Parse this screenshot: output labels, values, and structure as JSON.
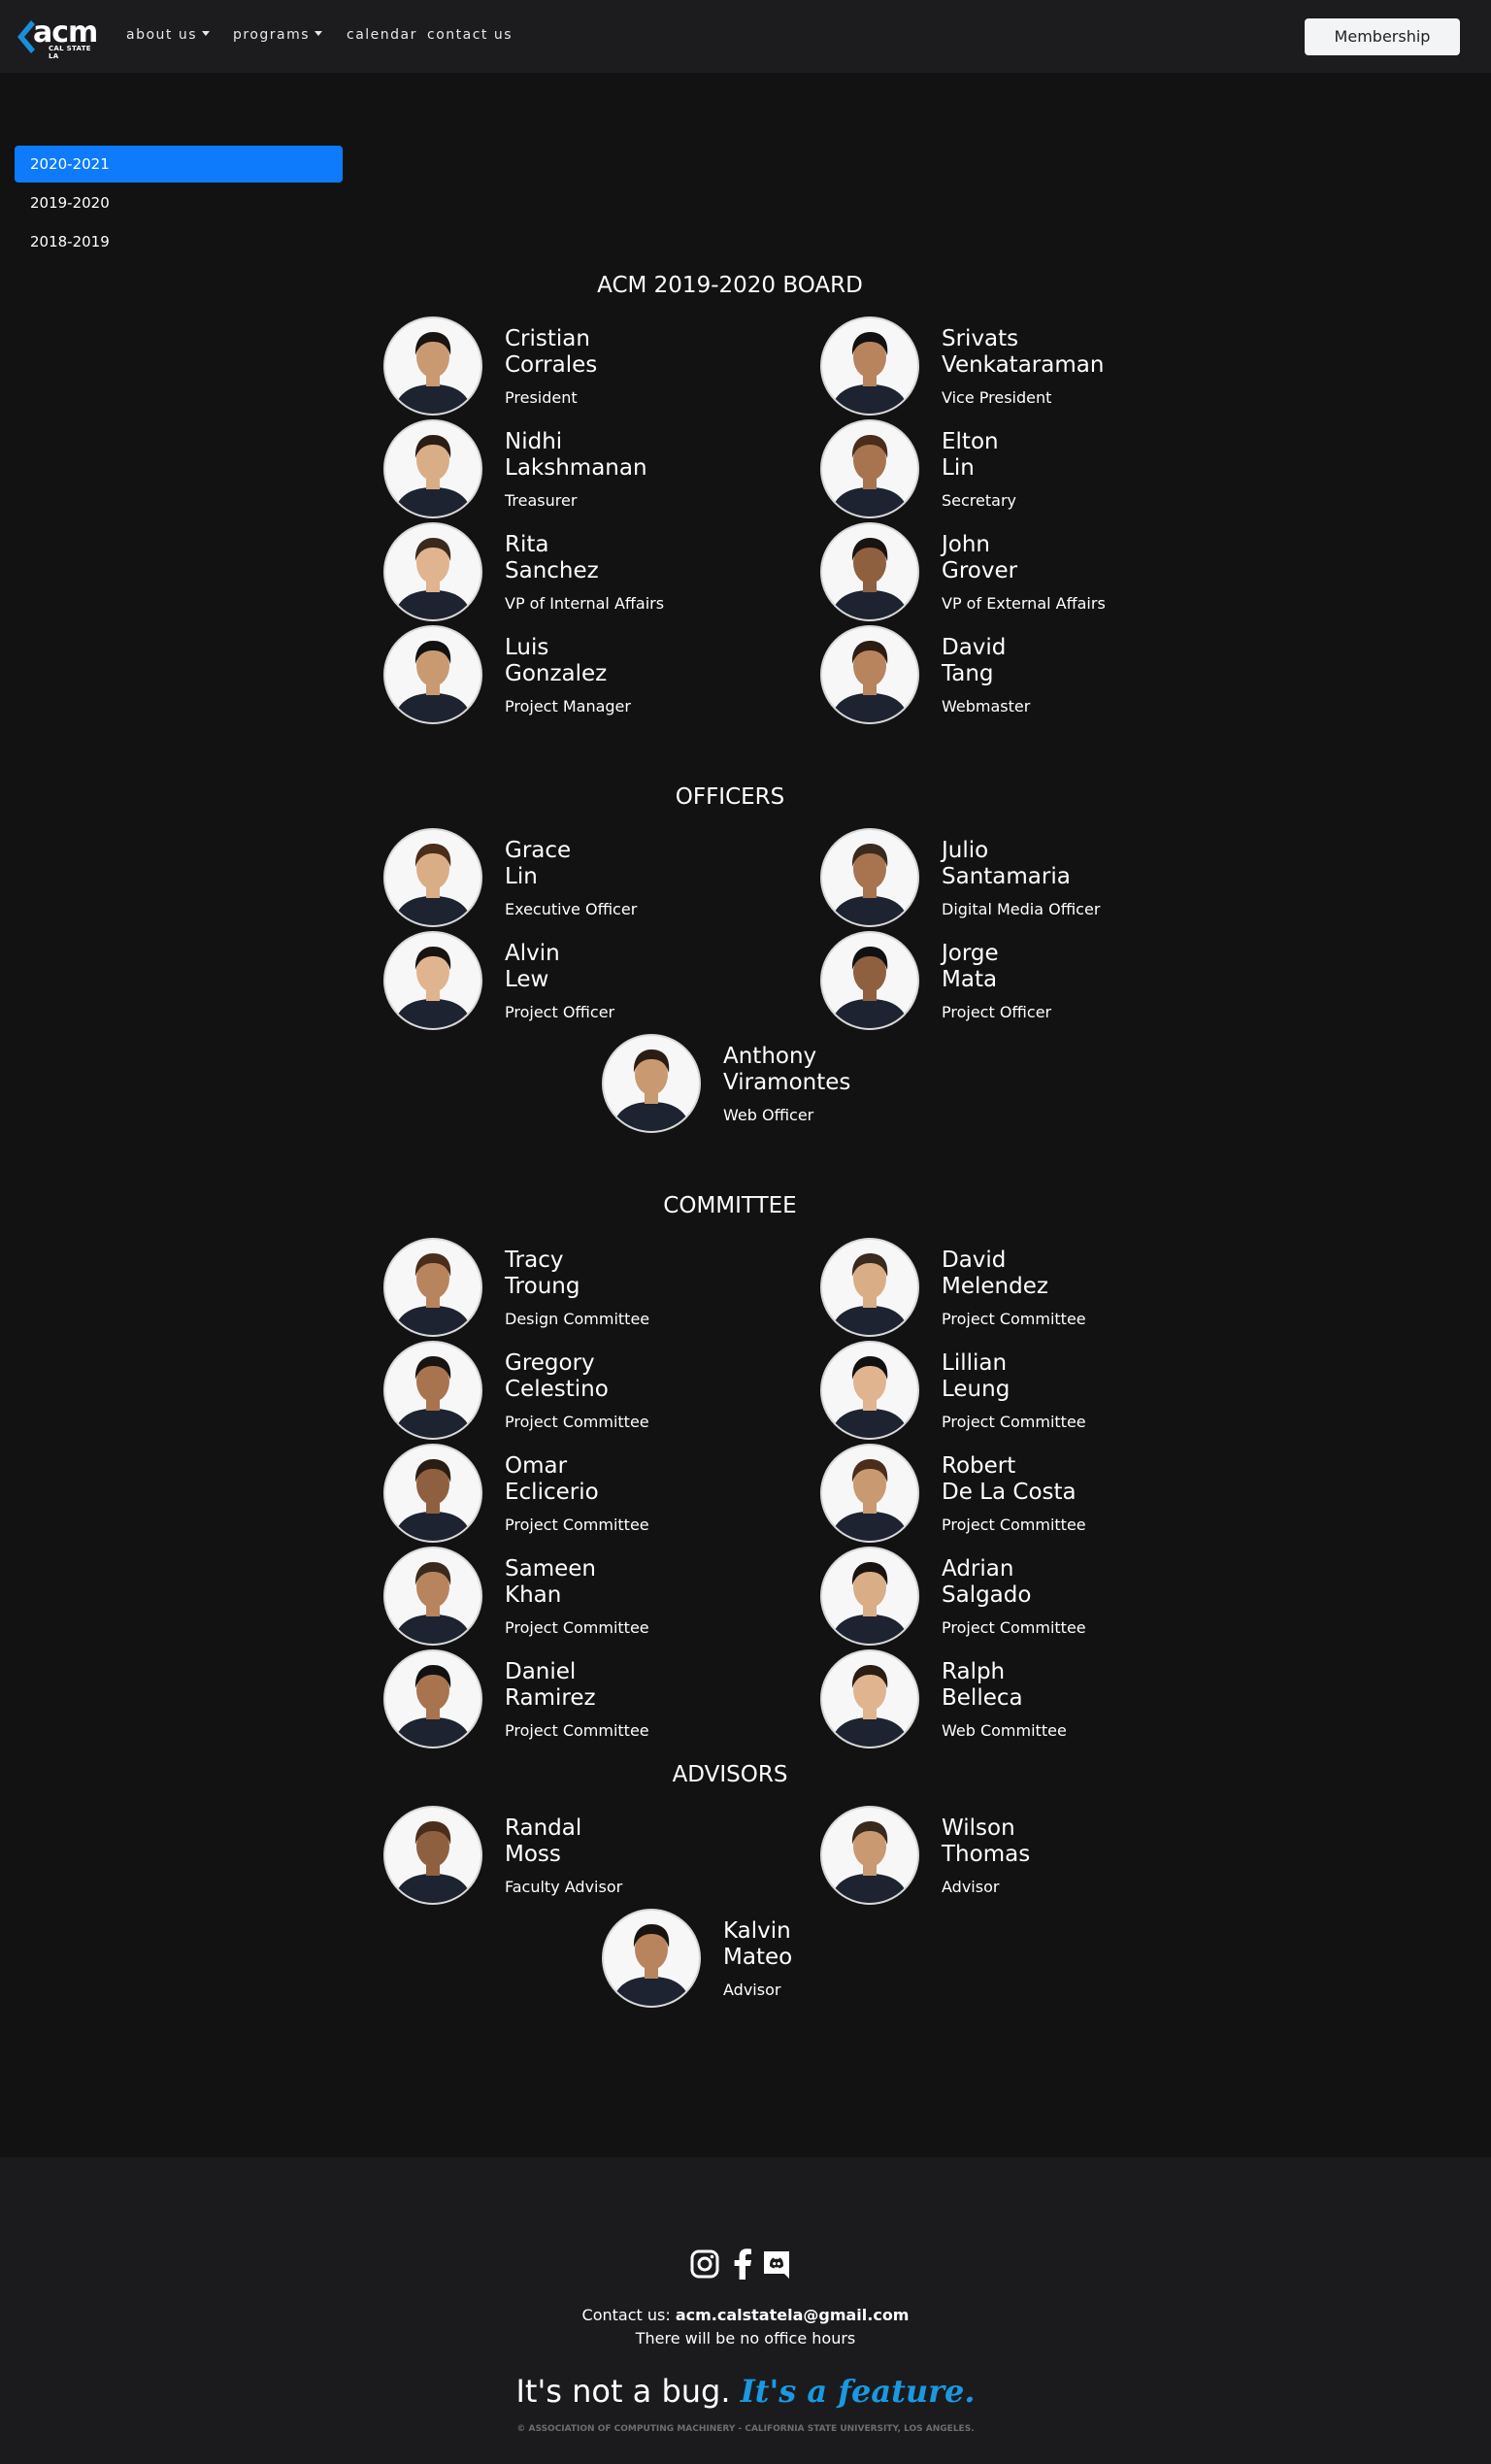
{
  "nav": {
    "logo_text": "acm",
    "logo_subtext": "CAL STATE LA",
    "links": [
      {
        "label": "about us",
        "dropdown": true
      },
      {
        "label": "programs",
        "dropdown": true
      },
      {
        "label": "calendar",
        "dropdown": false
      },
      {
        "label": "contact us",
        "dropdown": false
      }
    ],
    "membership_label": "Membership"
  },
  "sidebar": {
    "years": [
      "2020-2021",
      "2019-2020",
      "2018-2019"
    ],
    "active_index": 0
  },
  "sections": [
    {
      "title": "ACM 2019-2020 BOARD",
      "members": [
        {
          "first": "Cristian",
          "last": "Corrales",
          "role": "President"
        },
        {
          "first": "Srivats",
          "last": "Venkataraman",
          "role": "Vice President"
        },
        {
          "first": "Nidhi",
          "last": "Lakshmanan",
          "role": "Treasurer"
        },
        {
          "first": "Elton",
          "last": "Lin",
          "role": "Secretary"
        },
        {
          "first": "Rita",
          "last": "Sanchez",
          "role": "VP of Internal Affairs"
        },
        {
          "first": "John",
          "last": "Grover",
          "role": "VP of External Affairs"
        },
        {
          "first": "Luis",
          "last": "Gonzalez",
          "role": "Project Manager"
        },
        {
          "first": "David",
          "last": "Tang",
          "role": "Webmaster"
        }
      ]
    },
    {
      "title": "OFFICERS",
      "members": [
        {
          "first": "Grace",
          "last": "Lin",
          "role": "Executive Officer"
        },
        {
          "first": "Julio",
          "last": "Santamaria",
          "role": "Digital Media Officer"
        },
        {
          "first": "Alvin",
          "last": "Lew",
          "role": "Project Officer"
        },
        {
          "first": "Jorge",
          "last": "Mata",
          "role": "Project Officer"
        },
        {
          "first": "Anthony",
          "last": "Viramontes",
          "role": "Web Officer"
        }
      ]
    },
    {
      "title": "COMMITTEE",
      "members": [
        {
          "first": "Tracy",
          "last": "Troung",
          "role": "Design Committee"
        },
        {
          "first": "David",
          "last": "Melendez",
          "role": "Project Committee"
        },
        {
          "first": "Gregory",
          "last": "Celestino",
          "role": "Project Committee"
        },
        {
          "first": "Lillian",
          "last": "Leung",
          "role": "Project Committee"
        },
        {
          "first": "Omar",
          "last": "Eclicerio",
          "role": "Project Committee"
        },
        {
          "first": "Robert",
          "last": "De La Costa",
          "role": "Project Committee"
        },
        {
          "first": "Sameen",
          "last": "Khan",
          "role": "Project Committee"
        },
        {
          "first": "Adrian",
          "last": "Salgado",
          "role": "Project Committee"
        },
        {
          "first": "Daniel",
          "last": "Ramirez",
          "role": "Project Committee"
        },
        {
          "first": "Ralph",
          "last": "Belleca",
          "role": "Web Committee"
        }
      ]
    },
    {
      "title": "ADVISORS",
      "members": [
        {
          "first": "Randal",
          "last": "Moss",
          "role": "Faculty Advisor"
        },
        {
          "first": "Wilson",
          "last": "Thomas",
          "role": "Advisor"
        },
        {
          "first": "Kalvin",
          "last": "Mateo",
          "role": "Advisor"
        }
      ]
    }
  ],
  "footer": {
    "social_icons": [
      "instagram-icon",
      "facebook-icon",
      "discord-icon"
    ],
    "contact_prefix": "Contact us:",
    "contact_email": "acm.calstatela@gmail.com",
    "hours_note": "There will be no office hours",
    "tagline_plain": "It's not a bug.",
    "tagline_accent": "It's a feature.",
    "copyright": "© ASSOCIATION OF COMPUTING MACHINERY - CALIFORNIA STATE UNIVERSITY, LOS ANGELES."
  },
  "colors": {
    "accent": "#0d7bfc",
    "tagline_accent": "#1b98e0",
    "page_background": "#121212"
  }
}
